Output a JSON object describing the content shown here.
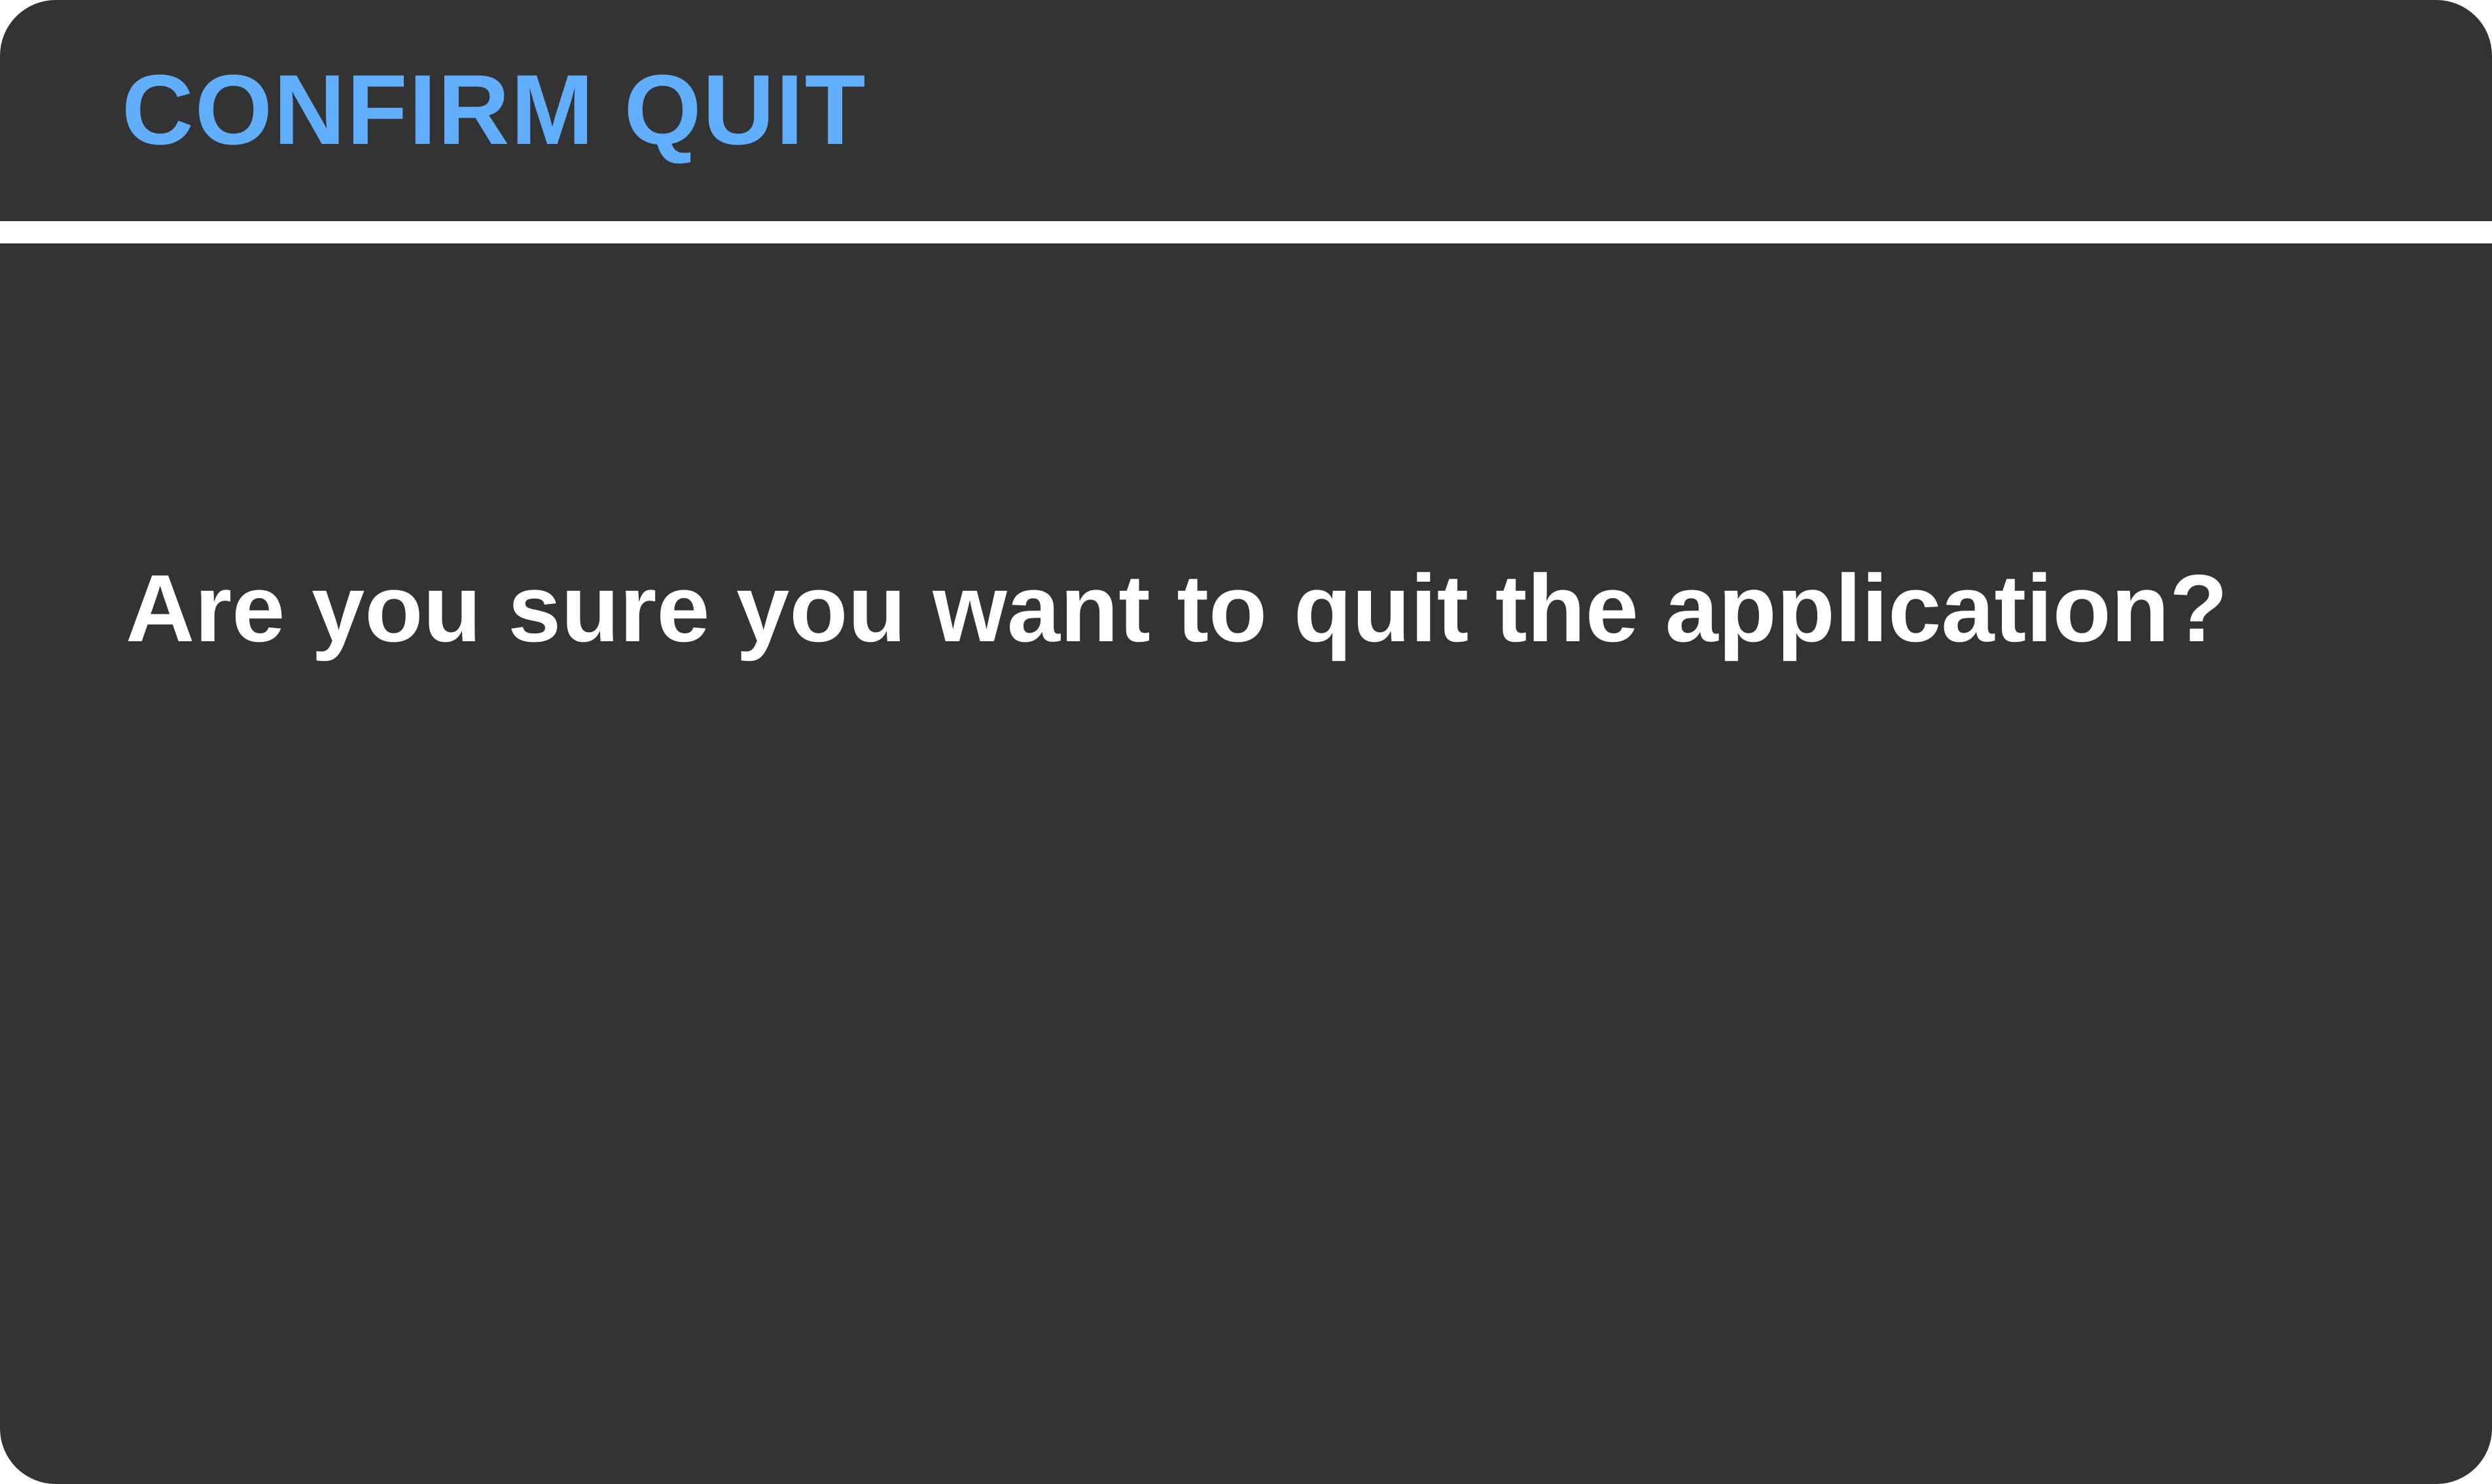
{
  "dialog": {
    "title": "CONFIRM QUIT",
    "message": "Are you sure you want to quit the application?"
  },
  "colors": {
    "background": "#333333",
    "title": "#60aefc",
    "text": "#ffffff",
    "separator": "#ffffff"
  }
}
